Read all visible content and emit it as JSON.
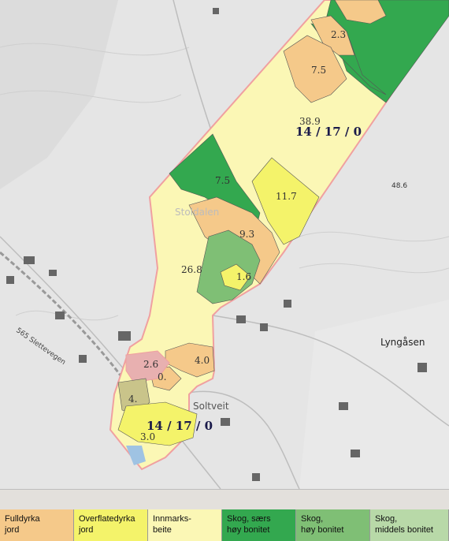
{
  "map": {
    "parcel_id_label": "14 / 17 / 0",
    "place_names": {
      "stoldalen": "Stoldalen",
      "lyngasen": "Lyngåsen",
      "sletteveien": "565 Slettevegen",
      "soltveit": "Soltveit"
    },
    "elevation": "48.6",
    "areas": [
      "2.3",
      "7.5",
      "38.9",
      "7.5",
      "11.7",
      "9.3",
      "26.8",
      "1.6",
      "4.0",
      "2.6",
      "0.",
      "4.",
      "3.0"
    ],
    "colors": {
      "fulldyrka": "#f5c98a",
      "overflatedyrka": "#f4f36a",
      "innmarksbeite": "#fbf7b5",
      "skog_saers": "#33a84f",
      "skog_hoy": "#7fbf75",
      "skog_middels": "#b8d9a8",
      "boundary": "#f0a0a0"
    }
  },
  "legend": [
    {
      "line1": "Fulldyrka",
      "line2": "jord",
      "color": "#f5c98a"
    },
    {
      "line1": "Overflatedyrka",
      "line2": "jord",
      "color": "#f4f36a"
    },
    {
      "line1": "Innmarks-",
      "line2": "beite",
      "color": "#fbf7b5"
    },
    {
      "line1": "Skog, særs",
      "line2": "høy bonitet",
      "color": "#33a84f"
    },
    {
      "line1": "Skog,",
      "line2": "høy bonitet",
      "color": "#7fbf75"
    },
    {
      "line1": "Skog,",
      "line2": "middels bonitet",
      "color": "#b8d9a8"
    }
  ]
}
